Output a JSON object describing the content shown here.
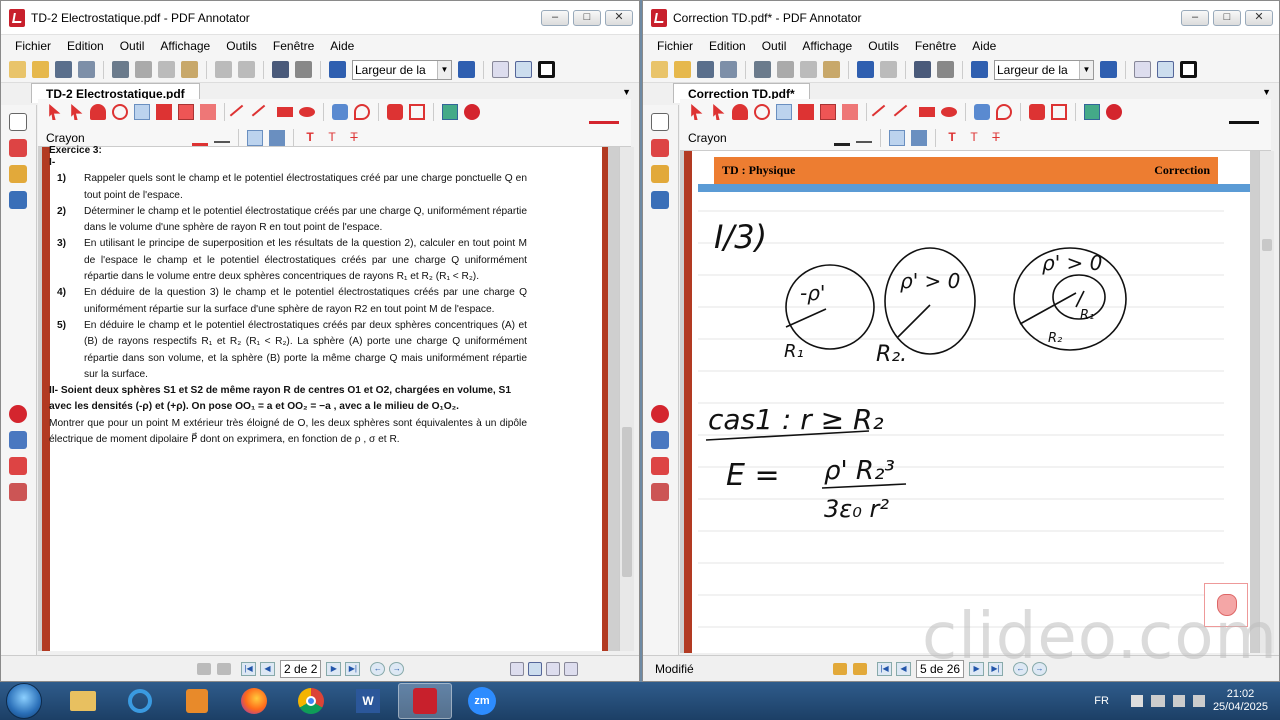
{
  "left_window": {
    "title": "TD-2 Electrostatique.pdf - PDF Annotator",
    "menu": [
      "Fichier",
      "Edition",
      "Outil",
      "Affichage",
      "Outils",
      "Fenêtre",
      "Aide"
    ],
    "zoom_value": "Largeur de la",
    "tab_label": "TD-2 Electrostatique.pdf",
    "tool_label": "Crayon",
    "page_indicator": "2 de 2",
    "exercise": {
      "heading": "Exercice 3:",
      "part1_label": "I-",
      "items": [
        {
          "num": "1)",
          "text": "Rappeler quels sont  le champ et le potentiel électrostatiques créé par une charge ponctuelle Q en tout point de l'espace."
        },
        {
          "num": "2)",
          "text": "Déterminer le champ et le potentiel électrostatique créés par une charge Q, uniformément répartie dans le volume d'une sphère de rayon R en tout point de l'espace."
        },
        {
          "num": "3)",
          "text": "En  utilisant le principe de superposition  et les résultats de la question 2), calculer en tout point M de l'espace le champ et le potentiel électrostatiques créés par une charge Q uniformément répartie dans le volume entre deux sphères concentriques de rayons R₁ et R₂ (R₁ < R₂)."
        },
        {
          "num": "4)",
          "text": "En déduire de la question 3) le champ et le potentiel électrostatiques créés par une charge Q uniformément répartie sur la surface d'une sphère de rayon R2 en tout point M de l'espace."
        },
        {
          "num": "5)",
          "text": "En déduire le champ et le potentiel électrostatiques créés par deux sphères concentriques (A) et (B) de rayons respectifs R₁ et R₂ (R₁ < R₂). La sphère (A) porte une charge Q uniformément répartie dans son volume, et la sphère (B) porte la même charge Q mais uniformément répartie sur la surface."
        }
      ],
      "part2_a": "II- Soient deux sphères S1 et S2 de même rayon R de centres O1 et O2, chargées en volume, S1 avec les densités (-ρ) et (+ρ). On pose OO₁ = a  et  OO₂ = −a , avec  a  le milieu de O₁O₂.",
      "part2_b": "Montrer que pour un point M extérieur très éloigné de O,  les deux sphères sont équivalentes à un dipôle électrique de moment dipolaire P⃗ dont on exprimera, en fonction de ρ , σ  et R."
    }
  },
  "right_window": {
    "title": "Correction TD.pdf* - PDF Annotator",
    "menu": [
      "Fichier",
      "Edition",
      "Outil",
      "Affichage",
      "Outils",
      "Fenêtre",
      "Aide"
    ],
    "zoom_value": "Largeur de la",
    "tab_label": "Correction TD.pdf*",
    "tool_label": "Crayon",
    "header_left": "TD : Physique",
    "header_right": "Correction",
    "status": "Modifié",
    "page_indicator": "5 de 26",
    "handwriting": {
      "q": "I/3)",
      "s1": "-ρ'",
      "s2": "ρ' > 0",
      "s3": "ρ' > 0",
      "r1": "R₁",
      "r2": "R₂",
      "r2b": "R₂.",
      "r1b": "R₁",
      "r2c": "R₂",
      "case": "cas1 : r ≥ R₂",
      "eq_lhs": "E =",
      "eq_num": "ρ' R₂³",
      "eq_den": "3ε₀ r²"
    }
  },
  "taskbar": {
    "lang": "FR",
    "time": "21:02",
    "date": "25/04/2025",
    "apps": [
      "start",
      "explorer",
      "ie",
      "media",
      "firefox",
      "chrome",
      "word",
      "pdf-annotator",
      "zoom"
    ]
  },
  "watermark": "clideo.com",
  "colors": {
    "accent_red": "#c8202c",
    "header_orange": "#ed7d31",
    "header_blue": "#5b9bd5",
    "strip_red": "#b23a22"
  }
}
